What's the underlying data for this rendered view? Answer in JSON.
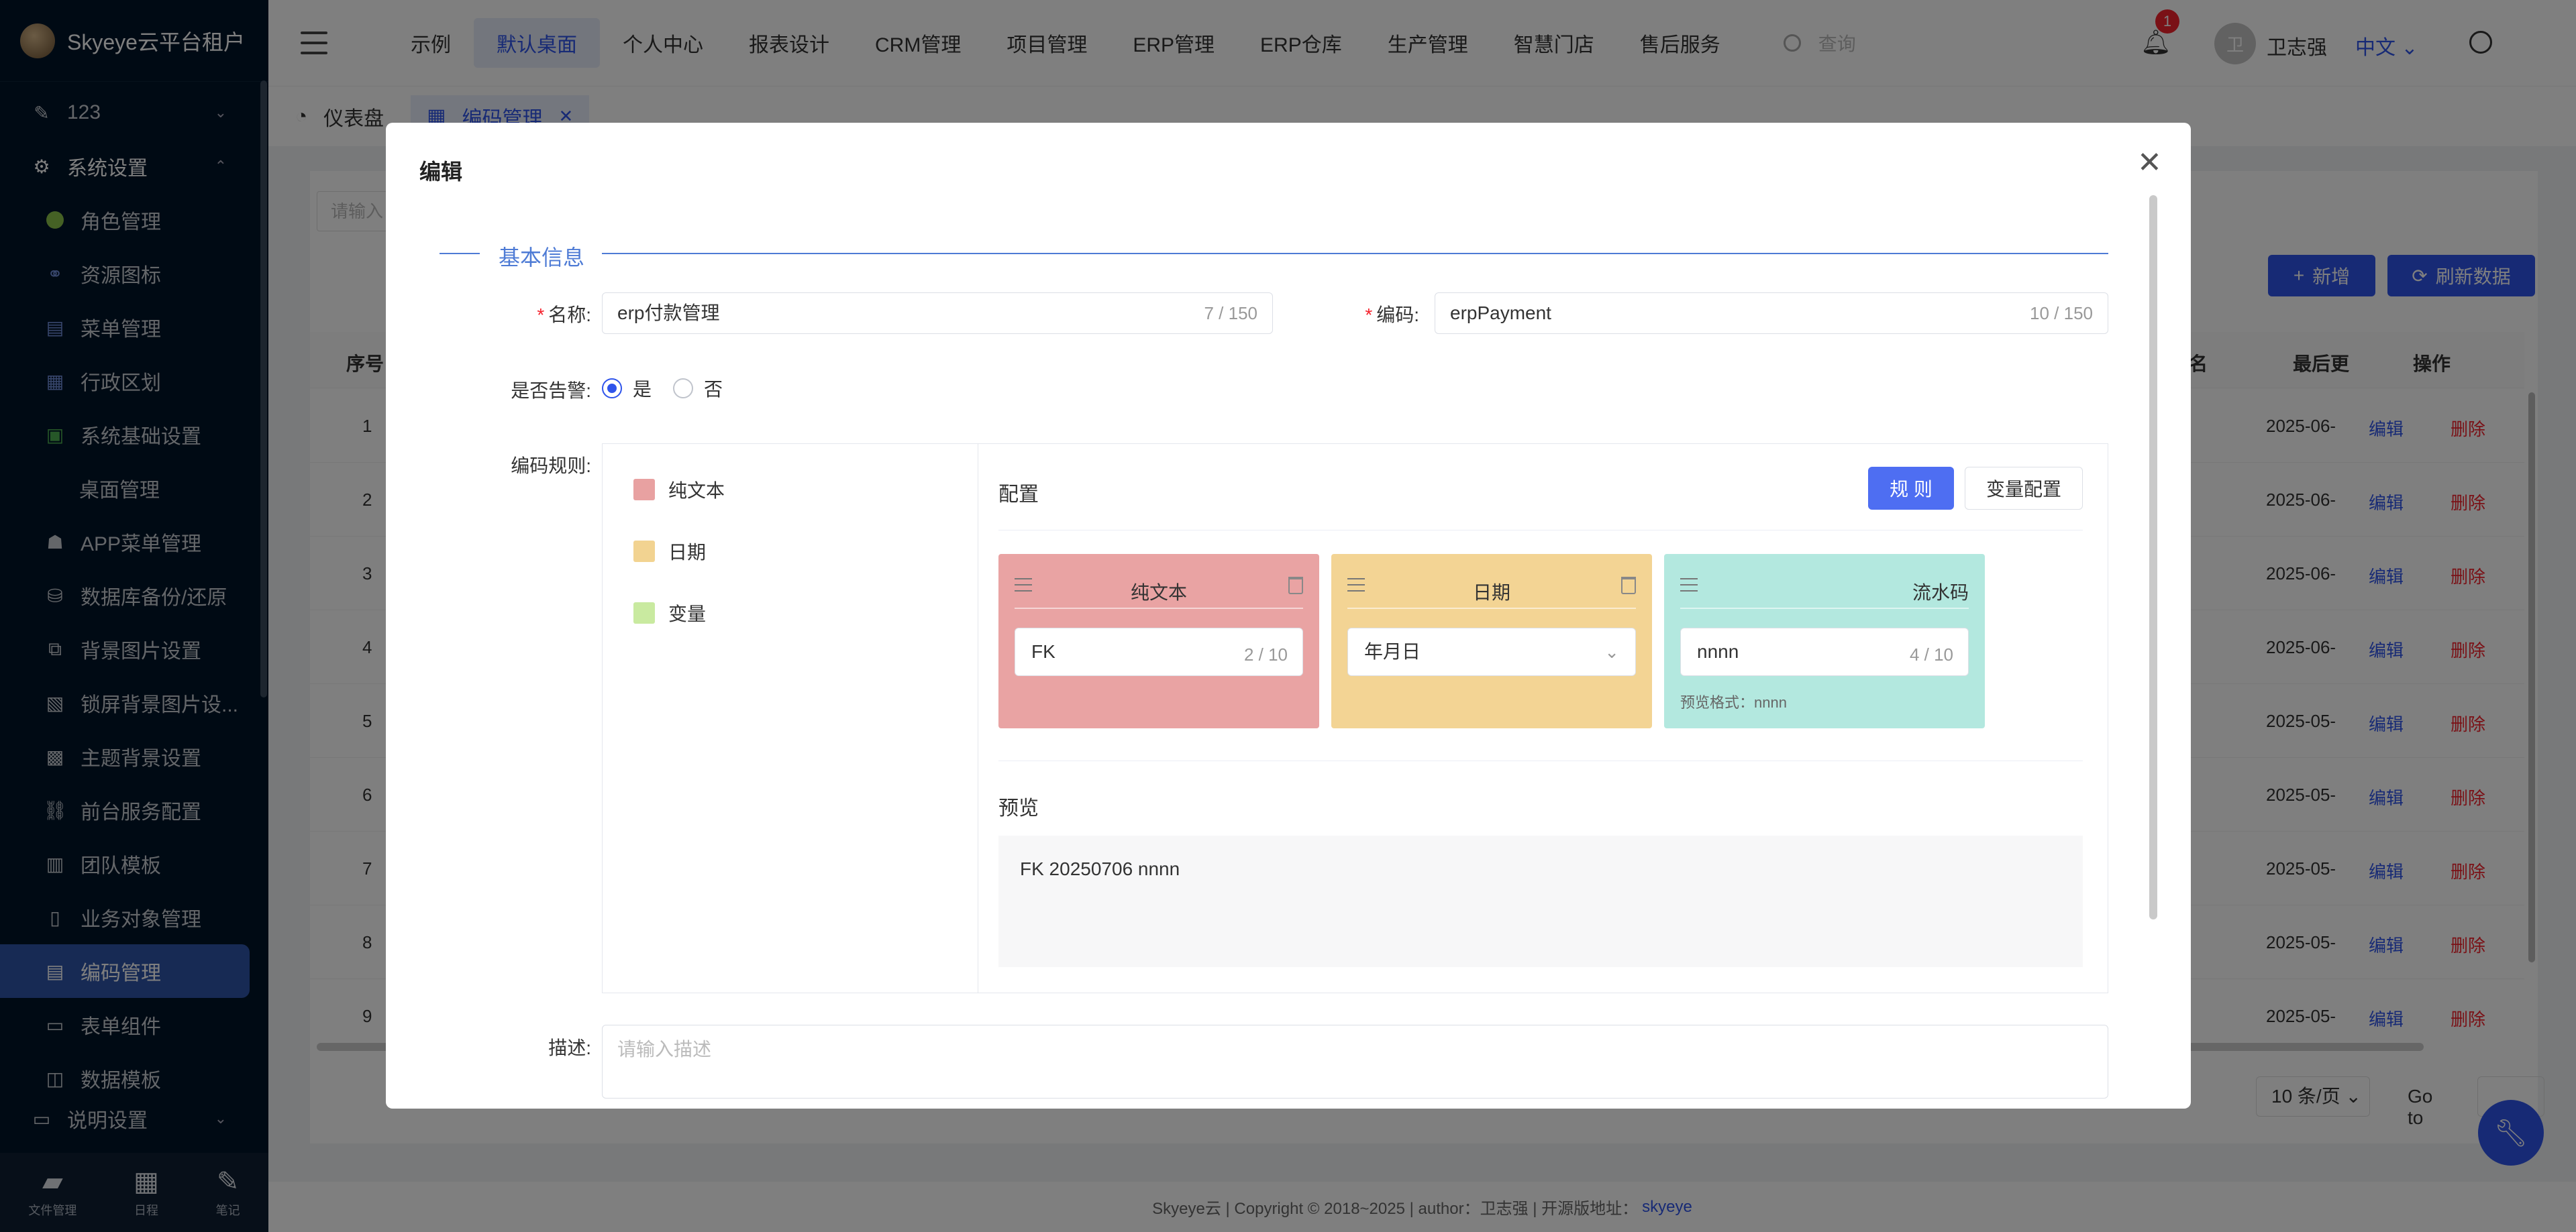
{
  "app": {
    "title": "Skyeye云平台租户"
  },
  "sidebar": {
    "items": [
      {
        "label": "123",
        "icon": "edit-icon"
      },
      {
        "label": "系统设置",
        "icon": "gear-icon"
      },
      {
        "label": "角色管理",
        "icon": "role-icon"
      },
      {
        "label": "资源图标",
        "icon": "resource-icon"
      },
      {
        "label": "菜单管理",
        "icon": "menu-icon"
      },
      {
        "label": "行政区划",
        "icon": "region-icon"
      },
      {
        "label": "系统基础设置",
        "icon": "settings-icon"
      },
      {
        "label": "桌面管理",
        "icon": ""
      },
      {
        "label": "APP菜单管理",
        "icon": "android-icon"
      },
      {
        "label": "数据库备份/还原",
        "icon": "database-icon"
      },
      {
        "label": "背景图片设置",
        "icon": "image-icon"
      },
      {
        "label": "锁屏背景图片设...",
        "icon": "lock-image-icon"
      },
      {
        "label": "主题背景设置",
        "icon": "theme-icon"
      },
      {
        "label": "前台服务配置",
        "icon": "link-icon"
      },
      {
        "label": "团队模板",
        "icon": "team-icon"
      },
      {
        "label": "业务对象管理",
        "icon": "object-icon"
      },
      {
        "label": "编码管理",
        "icon": "code-icon"
      },
      {
        "label": "表单组件",
        "icon": "form-icon"
      },
      {
        "label": "数据模板",
        "icon": "template-icon"
      },
      {
        "label": "说明设置",
        "icon": "doc-icon"
      }
    ],
    "bottom": [
      {
        "label": "文件管理",
        "icon": "folder-icon"
      },
      {
        "label": "日程",
        "icon": "calendar-icon"
      },
      {
        "label": "笔记",
        "icon": "note-icon"
      }
    ]
  },
  "header": {
    "tabs": [
      "示例",
      "默认桌面",
      "个人中心",
      "报表设计",
      "CRM管理",
      "项目管理",
      "ERP管理",
      "ERP仓库",
      "生产管理",
      "智慧门店",
      "售后服务"
    ],
    "active_tab": "默认桌面",
    "search_placeholder": "查询",
    "notifications": "1",
    "avatar_text": "卫",
    "user": "卫志强",
    "language": "中文"
  },
  "tabs_row": {
    "dashboard": "仪表盘",
    "current": "编码管理"
  },
  "page": {
    "filter_placeholder": "请输入",
    "add_button": "新增",
    "refresh_button": "刷新数据",
    "columns": {
      "index": "序号",
      "name_partial": "名",
      "last_partial": "最后更",
      "actions": "操作"
    },
    "rows": [
      {
        "index": "1",
        "date": "2025-06-"
      },
      {
        "index": "2",
        "date": "2025-06-"
      },
      {
        "index": "3",
        "date": "2025-06-"
      },
      {
        "index": "4",
        "date": "2025-06-"
      },
      {
        "index": "5",
        "date": "2025-05-"
      },
      {
        "index": "6",
        "date": "2025-05-"
      },
      {
        "index": "7",
        "date": "2025-05-"
      },
      {
        "index": "8",
        "date": "2025-05-"
      },
      {
        "index": "9",
        "date": "2025-05-"
      }
    ],
    "edit_label": "编辑",
    "delete_label": "删除",
    "page_size": "10 条/页",
    "goto_label": "Go to"
  },
  "footer": {
    "text": "Skyeye云 | Copyright © 2018~2025 | author：卫志强 | 开源版地址：",
    "link": "skyeye"
  },
  "modal": {
    "title": "编辑",
    "section": "基本信息",
    "name_label": "名称:",
    "name_value": "erp付款管理",
    "name_count": "7 / 150",
    "code_label": "编码:",
    "code_value": "erpPayment",
    "code_count": "10 / 150",
    "alarm_label": "是否告警:",
    "alarm_yes": "是",
    "alarm_no": "否",
    "alarm_value": "是",
    "rules_label": "编码规则:",
    "palette": [
      {
        "label": "纯文本",
        "color": "#e8a1a1"
      },
      {
        "label": "日期",
        "color": "#f2d391"
      },
      {
        "label": "变量",
        "color": "#c9eaa0"
      }
    ],
    "config_title": "配置",
    "rule_button": "规 则",
    "var_button": "变量配置",
    "cards": [
      {
        "title": "纯文本",
        "value": "FK",
        "count": "2 / 10",
        "color": "#e9a3a3"
      },
      {
        "title": "日期",
        "value": "年月日",
        "color": "#f3d494"
      },
      {
        "title": "流水码",
        "value": "nnnn",
        "count": "4 / 10",
        "hint": "预览格式：nnnn",
        "color": "#b3e8df"
      }
    ],
    "preview_title": "预览",
    "preview_value": "FK 20250706 nnnn",
    "desc_label": "描述:",
    "desc_placeholder": "请输入描述"
  }
}
